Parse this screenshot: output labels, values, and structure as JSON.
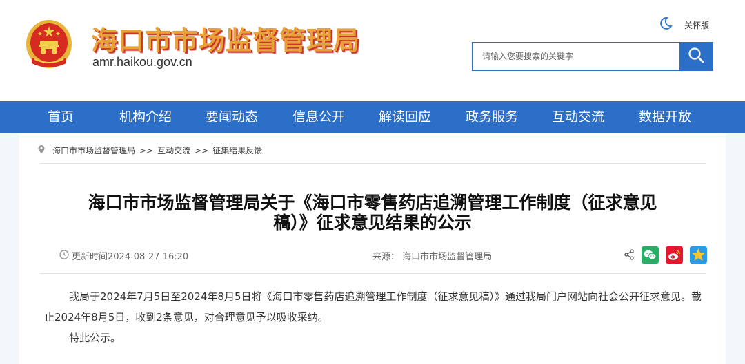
{
  "header": {
    "site_name": "海口市市场监督管理局",
    "domain": "amr.haikou.gov.cn",
    "care_mode_label": "关怀版",
    "search": {
      "placeholder": "请输入您要搜索的关键字",
      "value": ""
    }
  },
  "nav": {
    "items": [
      {
        "label": "首页"
      },
      {
        "label": "机构介绍"
      },
      {
        "label": "要闻动态"
      },
      {
        "label": "信息公开"
      },
      {
        "label": "解读回应"
      },
      {
        "label": "政务服务"
      },
      {
        "label": "互动交流"
      },
      {
        "label": "数据开放"
      }
    ]
  },
  "breadcrumb": {
    "items": [
      "海口市市场监督管理局",
      "互动交流",
      "征集结果反馈"
    ],
    "separator": ">>"
  },
  "article": {
    "title_line1": "海口市市场监督管理局关于《海口市零售药店追溯管理工作制度（征求意见",
    "title_line2": "稿）》征求意见结果的公示",
    "update_time": "更新时间2024-08-27 16:20",
    "source": "来源： 海口市市场监督管理局",
    "paragraph1": "我局于2024年7月5日至2024年8月5日将《海口市零售药店追溯管理工作制度（征求意见稿）》通过我局门户网站向社会公开征求意见。截止2024年8月5日，收到2条意见，对合理意见予以吸收采纳。",
    "paragraph2": "特此公示。"
  },
  "share": {
    "icons": [
      "share-icon",
      "wechat-icon",
      "weibo-icon",
      "qzone-icon"
    ]
  },
  "colors": {
    "brand_blue": "#2b6fc9",
    "title_gold": "#e8a23a",
    "title_shadow": "#c9352b",
    "wechat_green": "#2aae67",
    "weibo_red": "#e6162d",
    "qzone_blue": "#2b9be6"
  }
}
